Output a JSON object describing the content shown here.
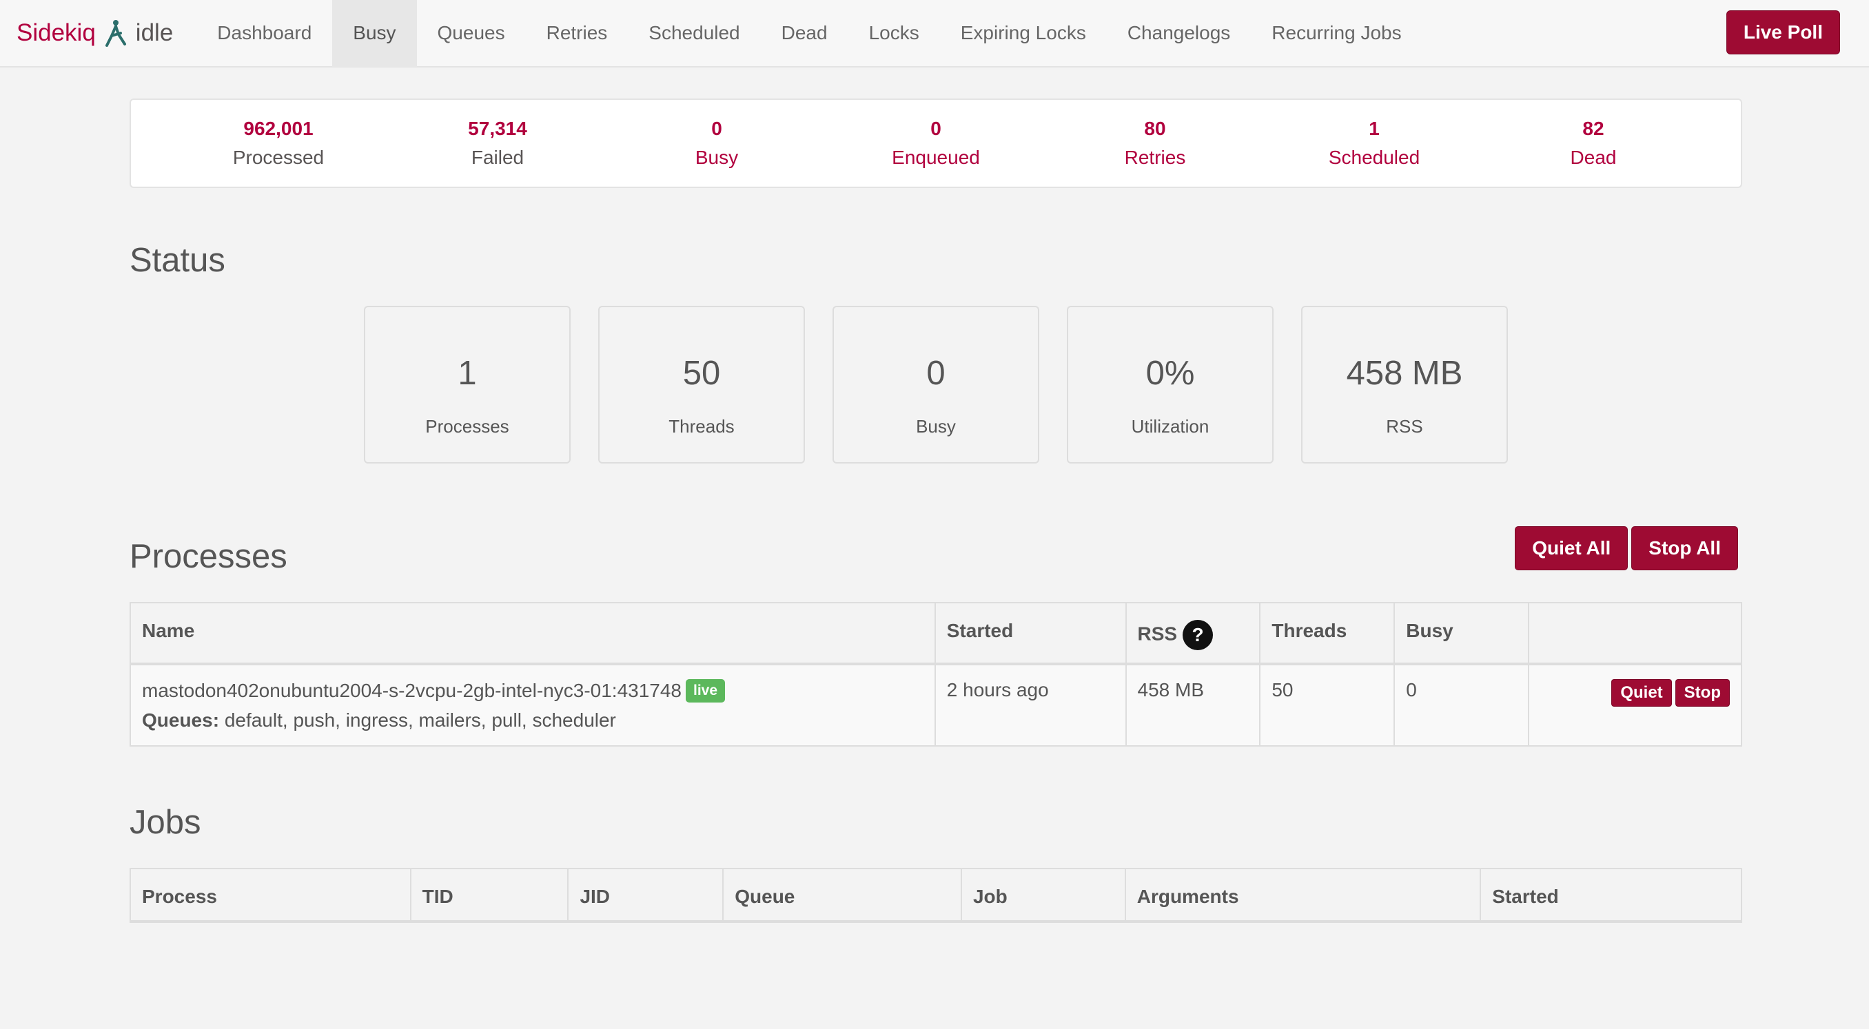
{
  "brand": {
    "name": "Sidekiq",
    "status": "idle"
  },
  "nav": {
    "items": [
      {
        "label": "Dashboard"
      },
      {
        "label": "Busy"
      },
      {
        "label": "Queues"
      },
      {
        "label": "Retries"
      },
      {
        "label": "Scheduled"
      },
      {
        "label": "Dead"
      },
      {
        "label": "Locks"
      },
      {
        "label": "Expiring Locks"
      },
      {
        "label": "Changelogs"
      },
      {
        "label": "Recurring Jobs"
      }
    ],
    "active": "Busy",
    "live_poll": "Live Poll"
  },
  "summary": [
    {
      "count": "962,001",
      "label": "Processed"
    },
    {
      "count": "57,314",
      "label": "Failed"
    },
    {
      "count": "0",
      "label": "Busy"
    },
    {
      "count": "0",
      "label": "Enqueued"
    },
    {
      "count": "80",
      "label": "Retries"
    },
    {
      "count": "1",
      "label": "Scheduled"
    },
    {
      "count": "82",
      "label": "Dead"
    }
  ],
  "status": {
    "title": "Status",
    "cards": [
      {
        "value": "1",
        "label": "Processes"
      },
      {
        "value": "50",
        "label": "Threads"
      },
      {
        "value": "0",
        "label": "Busy"
      },
      {
        "value": "0%",
        "label": "Utilization"
      },
      {
        "value": "458 MB",
        "label": "RSS"
      }
    ]
  },
  "processes": {
    "title": "Processes",
    "quiet_all": "Quiet All",
    "stop_all": "Stop All",
    "headers": {
      "name": "Name",
      "started": "Started",
      "rss": "RSS",
      "threads": "Threads",
      "busy": "Busy",
      "help": "?"
    },
    "rows": [
      {
        "name": "mastodon402onubuntu2004-s-2vcpu-2gb-intel-nyc3-01:431748",
        "badge": "live",
        "queues_label": "Queues:",
        "queues": "default, push, ingress, mailers, pull, scheduler",
        "started": "2 hours ago",
        "rss": "458 MB",
        "threads": "50",
        "busy": "0",
        "quiet": "Quiet",
        "stop": "Stop"
      }
    ]
  },
  "jobs": {
    "title": "Jobs",
    "headers": [
      "Process",
      "TID",
      "JID",
      "Queue",
      "Job",
      "Arguments",
      "Started"
    ]
  },
  "colors": {
    "accent": "#b1003e",
    "button": "#9e0b33",
    "live_badge": "#5cb85c"
  }
}
